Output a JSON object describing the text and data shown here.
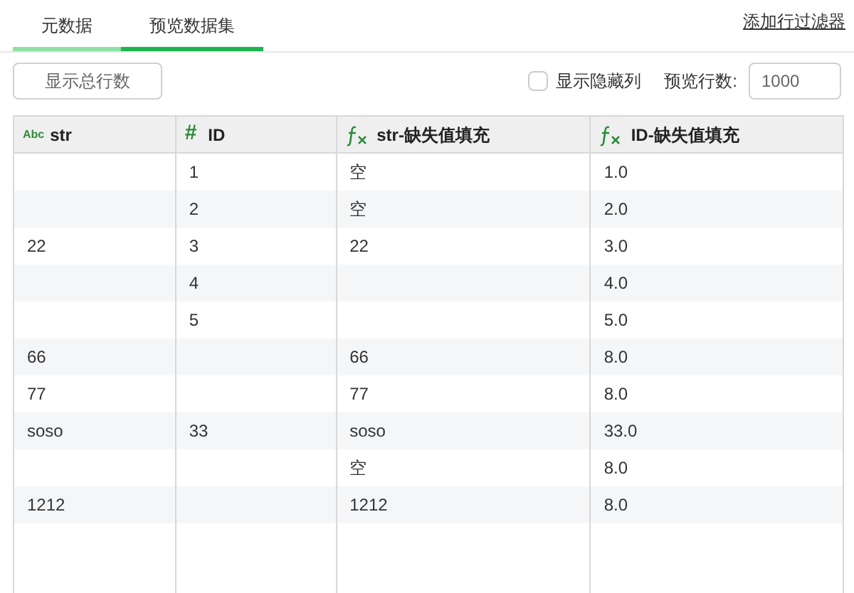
{
  "tabs": [
    {
      "label": "元数据",
      "selected": false
    },
    {
      "label": "预览数据集",
      "selected": true
    }
  ],
  "filter_link": "添加行过滤器",
  "toolbar": {
    "count_button": "显示总行数",
    "show_hidden": {
      "label": "显示隐藏列",
      "checked": false
    },
    "preview_rows_label": "预览行数:",
    "preview_rows_value": "1000"
  },
  "table": {
    "columns": [
      {
        "name": "str",
        "kind": "text",
        "icon": "Abc"
      },
      {
        "name": "ID",
        "kind": "number",
        "icon": "#"
      },
      {
        "name": "str-缺失值填充",
        "kind": "formula"
      },
      {
        "name": "ID-缺失值填充",
        "kind": "formula"
      }
    ],
    "rows": [
      [
        null,
        "1",
        "空",
        "1.0"
      ],
      [
        null,
        "2",
        "空",
        "2.0"
      ],
      [
        "22",
        "3",
        "22",
        "3.0"
      ],
      [
        null,
        "4",
        null,
        "4.0"
      ],
      [
        null,
        "5",
        null,
        "5.0"
      ],
      [
        "66",
        null,
        "66",
        "8.0"
      ],
      [
        "77",
        null,
        "77",
        "8.0"
      ],
      [
        "soso",
        "33",
        "soso",
        "33.0"
      ],
      [
        null,
        null,
        "空",
        "8.0"
      ],
      [
        "1212",
        null,
        "1212",
        "8.0"
      ],
      [
        null,
        null,
        null,
        null
      ]
    ]
  }
}
